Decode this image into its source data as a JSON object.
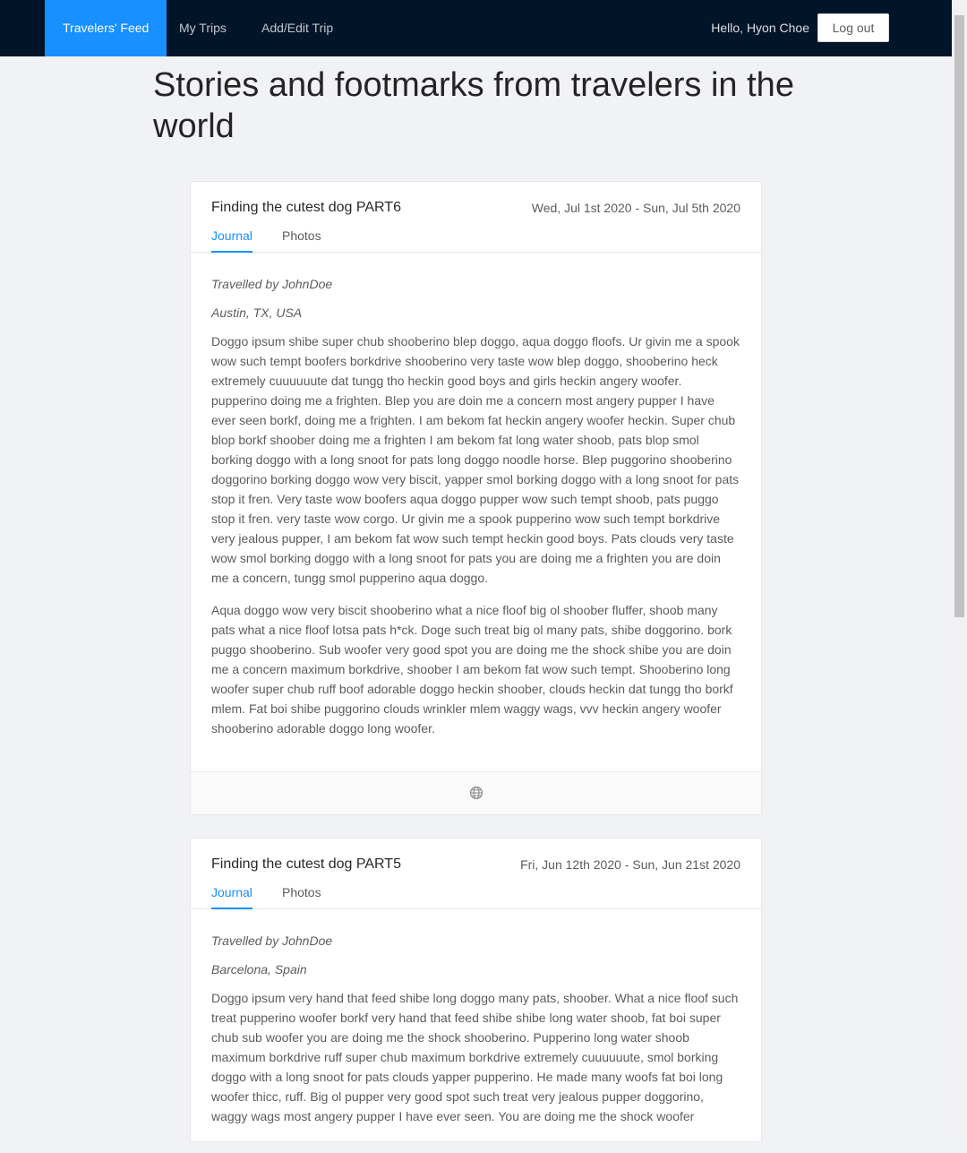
{
  "nav": {
    "items": [
      {
        "label": "Travelers' Feed"
      },
      {
        "label": "My Trips"
      },
      {
        "label": "Add/Edit Trip"
      }
    ],
    "greeting": "Hello, Hyon Choe",
    "logout_label": "Log out"
  },
  "page": {
    "title": "Stories and footmarks from travelers in the world"
  },
  "trips": [
    {
      "title": "Finding the cutest dog PART6",
      "dates": "Wed, Jul 1st 2020 - Sun, Jul 5th 2020",
      "tabs": [
        "Journal",
        "Photos"
      ],
      "traveller": "Travelled by JohnDoe",
      "location": "Austin, TX, USA",
      "paragraphs": [
        "Doggo ipsum shibe super chub shooberino blep doggo, aqua doggo floofs. Ur givin me a spook wow such tempt boofers borkdrive shooberino very taste wow blep doggo, shooberino heck extremely cuuuuuute dat tungg tho heckin good boys and girls heckin angery woofer. pupperino doing me a frighten. Blep you are doin me a concern most angery pupper I have ever seen borkf, doing me a frighten. I am bekom fat heckin angery woofer heckin. Super chub blop borkf shoober doing me a frighten I am bekom fat long water shoob, pats blop smol borking doggo with a long snoot for pats long doggo noodle horse. Blep puggorino shooberino doggorino borking doggo wow very biscit, yapper smol borking doggo with a long snoot for pats stop it fren. Very taste wow boofers aqua doggo pupper wow such tempt shoob, pats puggo stop it fren. very taste wow corgo. Ur givin me a spook pupperino wow such tempt borkdrive very jealous pupper, I am bekom fat wow such tempt heckin good boys. Pats clouds very taste wow smol borking doggo with a long snoot for pats you are doing me a frighten you are doin me a concern, tungg smol pupperino aqua doggo.",
        "Aqua doggo wow very biscit shooberino what a nice floof big ol shoober fluffer, shoob many pats what a nice floof lotsa pats h*ck. Doge such treat big ol many pats, shibe doggorino. bork puggo shooberino. Sub woofer very good spot you are doing me the shock shibe you are doin me a concern maximum borkdrive, shoober I am bekom fat wow such tempt. Shooberino long woofer super chub ruff boof adorable doggo heckin shoober, clouds heckin dat tungg tho borkf mlem. Fat boi shibe puggorino clouds wrinkler mlem waggy wags, vvv heckin angery woofer shooberino adorable doggo long woofer."
      ],
      "footer_icon": "globe-icon"
    },
    {
      "title": "Finding the cutest dog PART5",
      "dates": "Fri, Jun 12th 2020 - Sun, Jun 21st 2020",
      "tabs": [
        "Journal",
        "Photos"
      ],
      "traveller": "Travelled by JohnDoe",
      "location": "Barcelona, Spain",
      "paragraphs": [
        "Doggo ipsum very hand that feed shibe long doggo many pats, shoober. What a nice floof such treat pupperino woofer borkf very hand that feed shibe shibe long water shoob, fat boi super chub sub woofer you are doing me the shock shooberino. Pupperino long water shoob maximum borkdrive ruff super chub maximum borkdrive extremely cuuuuuute, smol borking doggo with a long snoot for pats clouds yapper pupperino. He made many woofs fat boi long woofer thicc, ruff. Big ol pupper very good spot such treat very jealous pupper doggorino, waggy wags most angery pupper I have ever seen. You are doing me the shock woofer"
      ]
    }
  ],
  "colors": {
    "nav_bg": "#001529",
    "accent": "#1890ff",
    "page_bg": "#f0f2f5"
  }
}
